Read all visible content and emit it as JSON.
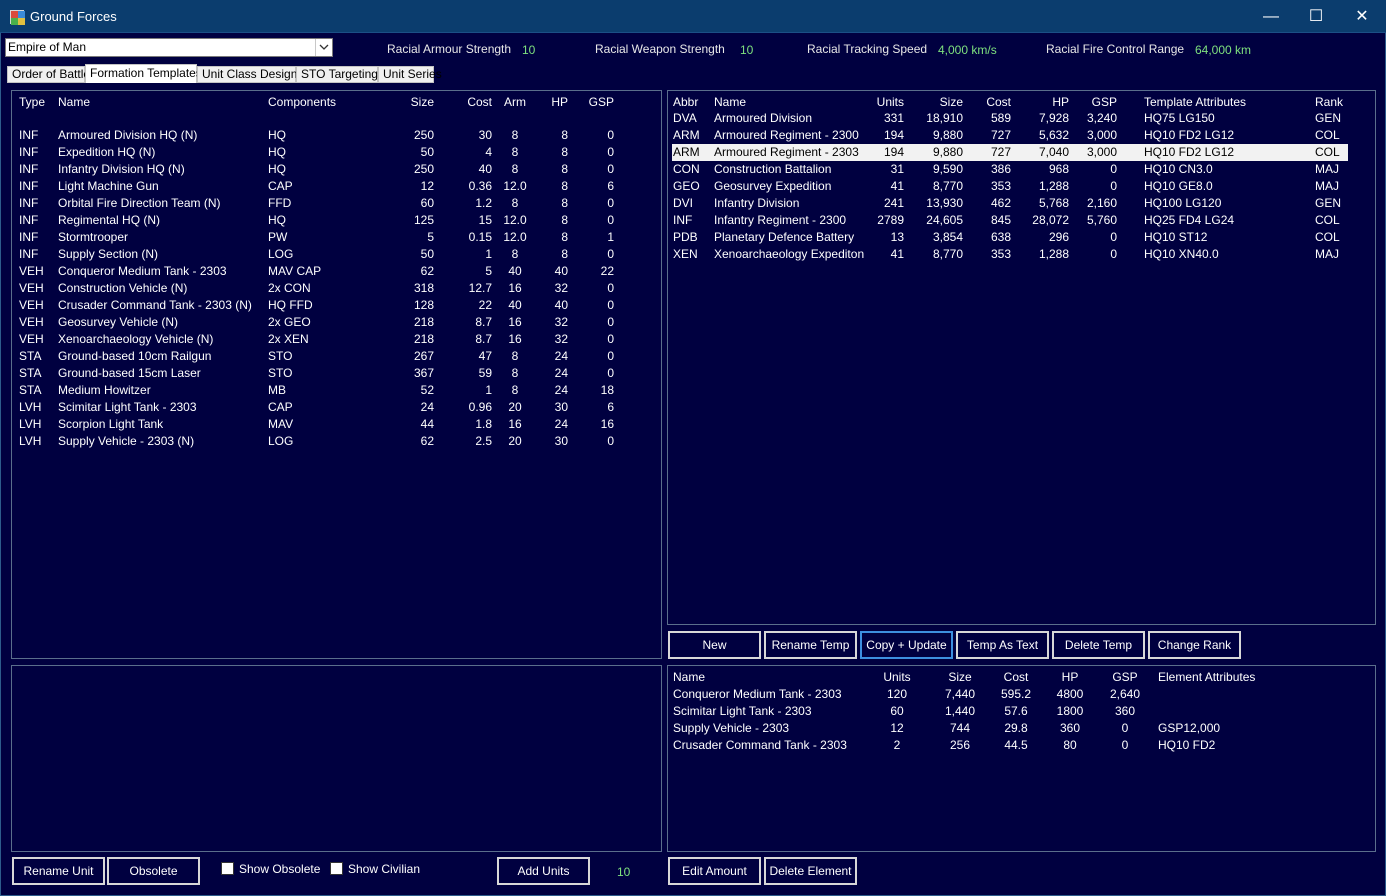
{
  "window": {
    "title": "Ground Forces",
    "minimize": "—",
    "maximize": "☐",
    "close": "✕"
  },
  "empire_select": {
    "value": "Empire of Man"
  },
  "racial": {
    "armour_label": "Racial Armour Strength",
    "armour_value": "10",
    "weapon_label": "Racial Weapon Strength",
    "weapon_value": "10",
    "tracking_label": "Racial Tracking Speed",
    "tracking_value": "4,000 km/s",
    "firecontrol_label": "Racial Fire Control Range",
    "firecontrol_value": "64,000 km"
  },
  "tabs": [
    "Order of Battle",
    "Formation Templates",
    "Unit Class Design",
    "STO Targeting",
    "Unit Series"
  ],
  "unit_table": {
    "headers": [
      "Type",
      "Name",
      "Components",
      "Size",
      "Cost",
      "Arm",
      "HP",
      "GSP"
    ],
    "rows": [
      [
        "INF",
        "Armoured Division HQ  (N)",
        "HQ",
        "250",
        "30",
        "8",
        "8",
        "0"
      ],
      [
        "INF",
        "Expedition HQ  (N)",
        "HQ",
        "50",
        "4",
        "8",
        "8",
        "0"
      ],
      [
        "INF",
        "Infantry Division HQ  (N)",
        "HQ",
        "250",
        "40",
        "8",
        "8",
        "0"
      ],
      [
        "INF",
        "Light Machine Gun",
        "CAP",
        "12",
        "0.36",
        "12.0",
        "8",
        "6"
      ],
      [
        "INF",
        "Orbital Fire Direction Team  (N)",
        "FFD",
        "60",
        "1.2",
        "8",
        "8",
        "0"
      ],
      [
        "INF",
        "Regimental HQ  (N)",
        "HQ",
        "125",
        "15",
        "12.0",
        "8",
        "0"
      ],
      [
        "INF",
        "Stormtrooper",
        "PW",
        "5",
        "0.15",
        "12.0",
        "8",
        "1"
      ],
      [
        "INF",
        "Supply Section  (N)",
        "LOG",
        "50",
        "1",
        "8",
        "8",
        "0"
      ],
      [
        "VEH",
        "Conqueror Medium Tank - 2303",
        "MAV   CAP",
        "62",
        "5",
        "40",
        "40",
        "22"
      ],
      [
        "VEH",
        "Construction Vehicle  (N)",
        "2x CON",
        "318",
        "12.7",
        "16",
        "32",
        "0"
      ],
      [
        "VEH",
        "Crusader Command Tank - 2303  (N)",
        "HQ   FFD",
        "128",
        "22",
        "40",
        "40",
        "0"
      ],
      [
        "VEH",
        "Geosurvey Vehicle  (N)",
        "2x GEO",
        "218",
        "8.7",
        "16",
        "32",
        "0"
      ],
      [
        "VEH",
        "Xenoarchaeology Vehicle  (N)",
        "2x XEN",
        "218",
        "8.7",
        "16",
        "32",
        "0"
      ],
      [
        "STA",
        "Ground-based 10cm Railgun",
        "STO",
        "267",
        "47",
        "8",
        "24",
        "0"
      ],
      [
        "STA",
        "Ground-based 15cm Laser",
        "STO",
        "367",
        "59",
        "8",
        "24",
        "0"
      ],
      [
        "STA",
        "Medium Howitzer",
        "MB",
        "52",
        "1",
        "8",
        "24",
        "18"
      ],
      [
        "LVH",
        "Scimitar Light Tank - 2303",
        "CAP",
        "24",
        "0.96",
        "20",
        "30",
        "6"
      ],
      [
        "LVH",
        "Scorpion Light Tank",
        "MAV",
        "44",
        "1.8",
        "16",
        "24",
        "16"
      ],
      [
        "LVH",
        "Supply Vehicle - 2303  (N)",
        "LOG",
        "62",
        "2.5",
        "20",
        "30",
        "0"
      ]
    ]
  },
  "template_table": {
    "headers": [
      "Abbr",
      "Name",
      "Units",
      "Size",
      "Cost",
      "HP",
      "GSP",
      "Template Attributes",
      "Rank"
    ],
    "selected_index": 2,
    "rows": [
      [
        "DVA",
        "Armoured Division",
        "331",
        "18,910",
        "589",
        "7,928",
        "3,240",
        "HQ75  LG150",
        "GEN"
      ],
      [
        "ARM",
        "Armoured Regiment - 2300",
        "194",
        "9,880",
        "727",
        "5,632",
        "3,000",
        "HQ10  FD2  LG12",
        "COL"
      ],
      [
        "ARM",
        "Armoured Regiment - 2303",
        "194",
        "9,880",
        "727",
        "7,040",
        "3,000",
        "HQ10  FD2  LG12",
        "COL"
      ],
      [
        "CON",
        "Construction Battalion",
        "31",
        "9,590",
        "386",
        "968",
        "0",
        "HQ10  CN3.0",
        "MAJ"
      ],
      [
        "GEO",
        "Geosurvey Expedition",
        "41",
        "8,770",
        "353",
        "1,288",
        "0",
        "HQ10  GE8.0",
        "MAJ"
      ],
      [
        "DVI",
        "Infantry Division",
        "241",
        "13,930",
        "462",
        "5,768",
        "2,160",
        "HQ100  LG120",
        "GEN"
      ],
      [
        "INF",
        "Infantry Regiment - 2300",
        "2789",
        "24,605",
        "845",
        "28,072",
        "5,760",
        "HQ25  FD4  LG24",
        "COL"
      ],
      [
        "PDB",
        "Planetary Defence Battery",
        "13",
        "3,854",
        "638",
        "296",
        "0",
        "HQ10  ST12",
        "COL"
      ],
      [
        "XEN",
        "Xenoarchaeology Expediton",
        "41",
        "8,770",
        "353",
        "1,288",
        "0",
        "HQ10  XN40.0",
        "MAJ"
      ]
    ]
  },
  "template_buttons": [
    "New",
    "Rename Temp",
    "Copy + Update",
    "Temp As Text",
    "Delete Temp",
    "Change Rank"
  ],
  "element_table": {
    "headers": [
      "Name",
      "Units",
      "Size",
      "Cost",
      "HP",
      "GSP",
      "Element Attributes"
    ],
    "rows": [
      [
        "Conqueror Medium Tank - 2303",
        "120",
        "7,440",
        "595.2",
        "4800",
        "2,640",
        ""
      ],
      [
        "Scimitar Light Tank - 2303",
        "60",
        "1,440",
        "57.6",
        "1800",
        "360",
        ""
      ],
      [
        "Supply Vehicle - 2303",
        "12",
        "744",
        "29.8",
        "360",
        "0",
        "GSP12,000"
      ],
      [
        "Crusader Command Tank - 2303",
        "2",
        "256",
        "44.5",
        "80",
        "0",
        "HQ10  FD2"
      ]
    ]
  },
  "bottom_left": {
    "rename_unit": "Rename Unit",
    "obsolete": "Obsolete",
    "show_obsolete": "Show Obsolete",
    "show_civilian": "Show Civilian",
    "add_units": "Add Units",
    "add_amount": "10"
  },
  "bottom_right": {
    "edit_amount": "Edit Amount",
    "delete_element": "Delete Element"
  },
  "colors": {
    "background": "#000040",
    "titlebar": "#0b3d6e",
    "value_green": "#7ee07e"
  }
}
